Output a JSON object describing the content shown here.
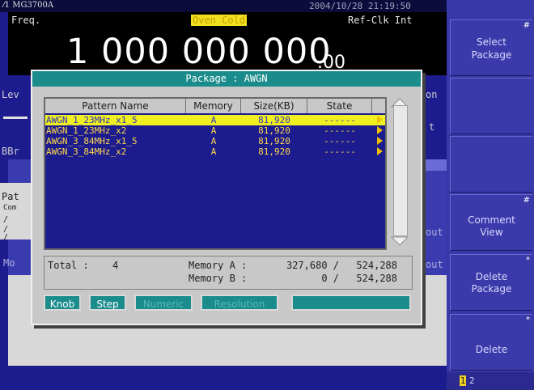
{
  "window": {
    "brand": "MG3700A",
    "datetime": "2004/10/28  21:19:50"
  },
  "frequency": {
    "label": "Freq.",
    "oven_status": "Oven Cold",
    "ref_clock": "Ref-Clk Int",
    "value": "1 000 000 000",
    "decimal": ".00"
  },
  "background": {
    "lev_label": "Lev",
    "bb_label": "BBr",
    "pat_label": "Pat",
    "com_label": "Com",
    "mo_label": "Mo",
    "on_label": "on",
    "t_label": "t",
    "out_label_1": "out",
    "out_label_2": "out"
  },
  "dialog": {
    "title": "Package : AWGN",
    "columns": [
      "Pattern Name",
      "Memory",
      "Size(KB)",
      "State"
    ],
    "rows": [
      {
        "name": "AWGN_1_23MHz_x1_5",
        "memory": "A",
        "size": "81,920",
        "state": "------",
        "selected": true
      },
      {
        "name": "AWGN_1_23MHz_x2",
        "memory": "A",
        "size": "81,920",
        "state": "------",
        "selected": false
      },
      {
        "name": "AWGN_3_84MHz_x1_5",
        "memory": "A",
        "size": "81,920",
        "state": "------",
        "selected": false
      },
      {
        "name": "AWGN_3_84MHz_x2",
        "memory": "A",
        "size": "81,920",
        "state": "------",
        "selected": false
      }
    ],
    "total_label": "Total :",
    "total_value": "4",
    "mem_a_label": "Memory A :",
    "mem_a_used": "327,680 /",
    "mem_a_total": "524,288",
    "mem_b_label": "Memory B :",
    "mem_b_used": "0 /",
    "mem_b_total": "524,288",
    "buttons": [
      {
        "label": "Knob",
        "active": true
      },
      {
        "label": "Step",
        "active": true
      },
      {
        "label": "Numeric",
        "active": false
      },
      {
        "label": "Resolution",
        "active": false
      }
    ]
  },
  "softkeys": [
    {
      "line1": "Select",
      "line2": "Package",
      "marker": "#"
    },
    {
      "line1": "",
      "line2": "",
      "marker": ""
    },
    {
      "line1": "",
      "line2": "",
      "marker": ""
    },
    {
      "line1": "Comment",
      "line2": "View",
      "marker": "#"
    },
    {
      "line1": "Delete",
      "line2": "Package",
      "marker": "*"
    },
    {
      "line1": "Delete",
      "line2": "",
      "marker": "*"
    }
  ],
  "pages": {
    "current": "1",
    "other": "2"
  },
  "colors": {
    "accent": "#1a8c8c",
    "selection": "#f0f020",
    "screen": "#1c1c8e"
  }
}
